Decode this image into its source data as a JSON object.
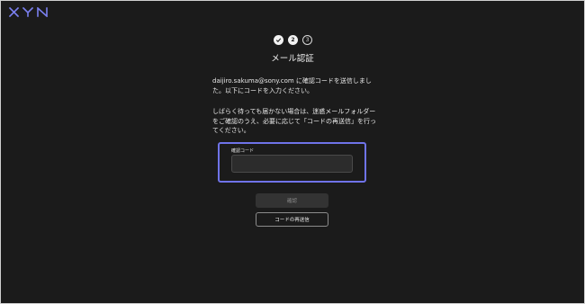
{
  "brand": {
    "logo_text": "XYN",
    "logo_color": "#7b80f0"
  },
  "steps": [
    {
      "label": "",
      "state": "done",
      "icon": "check-icon"
    },
    {
      "label": "2",
      "state": "current"
    },
    {
      "label": "3",
      "state": "upcoming"
    }
  ],
  "page": {
    "title": "メール認証",
    "message_1": "daijiro.sakuma@sony.com に確認コードを送信しました。以下にコードを入力ください。",
    "message_2": "しばらく待っても届かない場合は、迷惑メールフォルダーをご確認のうえ、必要に応じて「コードの再送信」を行ってください。"
  },
  "form": {
    "code_label": "確認コード",
    "code_value": "",
    "confirm_label": "確認",
    "resend_label": "コードの再送信"
  },
  "colors": {
    "background": "#1b1b1b",
    "highlight_border": "#6f73e8",
    "text": "#f2f2f2"
  }
}
